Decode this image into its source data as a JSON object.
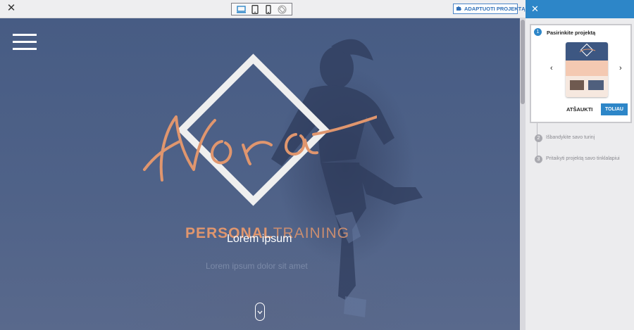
{
  "topbar": {
    "close_icon": "close-icon",
    "devices": [
      "desktop-icon",
      "tablet-icon",
      "mobile-icon",
      "rotate-icon"
    ],
    "adapt_button_label": "ADAPTUOTI PROJEKTĄ",
    "adapt_icon": "puzzle-icon"
  },
  "preview": {
    "logo_script": "Nora",
    "brand_part1": "PERSONAL",
    "brand_part2": "TRAINING",
    "title": "Lorem ipsum",
    "subtitle": "Lorem ipsum dolor sit amet",
    "menu_icon": "hamburger-icon",
    "scroll_icon": "chevron-down-icon"
  },
  "panel": {
    "close_icon": "close-icon",
    "steps": [
      {
        "number": "1",
        "label": "Pasirinkite projektą"
      },
      {
        "number": "2",
        "label": "Išbandykite savo turinį"
      },
      {
        "number": "3",
        "label": "Pritaikyti projektą savo tinklalapiui"
      }
    ],
    "prev_icon": "chevron-left-icon",
    "next_icon": "chevron-right-icon",
    "cancel_label": "ATŠAUKTI",
    "next_label": "TOLIAU"
  },
  "colors": {
    "accent": "#2d86c8",
    "brand_orange": "#e0966e",
    "hero_blue": "#4f6288"
  }
}
